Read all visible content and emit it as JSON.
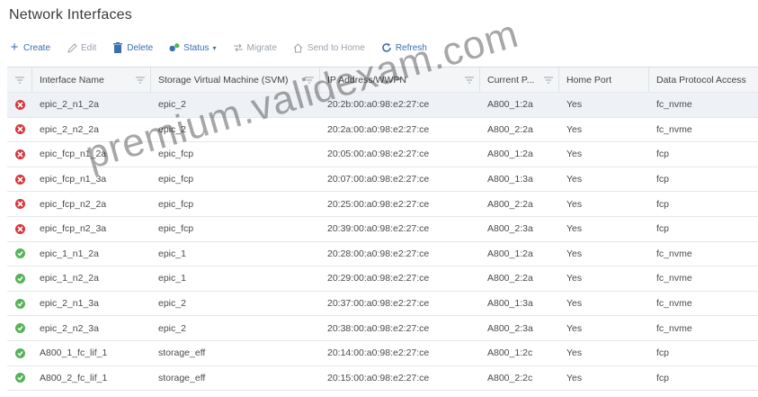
{
  "page": {
    "title": "Network Interfaces"
  },
  "toolbar": {
    "create": "Create",
    "edit": "Edit",
    "delete": "Delete",
    "status": "Status",
    "migrate": "Migrate",
    "send_home": "Send to Home",
    "refresh": "Refresh"
  },
  "colors": {
    "accent": "#3a6fb0",
    "error": "#d9363e",
    "ok": "#57b35a"
  },
  "table": {
    "columns": [
      "Interface Name",
      "Storage Virtual Machine (SVM)",
      "IP Address/WWPN",
      "Current P...",
      "Home Port",
      "Data Protocol Access"
    ],
    "rows": [
      {
        "status": "error",
        "name": "epic_2_n1_2a",
        "svm": "epic_2",
        "ip": "20:2b:00:a0:98:e2:27:ce",
        "port": "A800_1:2a",
        "home": "Yes",
        "proto": "fc_nvme"
      },
      {
        "status": "error",
        "name": "epic_2_n2_2a",
        "svm": "epic_2",
        "ip": "20:2a:00:a0:98:e2:27:ce",
        "port": "A800_2:2a",
        "home": "Yes",
        "proto": "fc_nvme"
      },
      {
        "status": "error",
        "name": "epic_fcp_n1_2a",
        "svm": "epic_fcp",
        "ip": "20:05:00:a0:98:e2:27:ce",
        "port": "A800_1:2a",
        "home": "Yes",
        "proto": "fcp"
      },
      {
        "status": "error",
        "name": "epic_fcp_n1_3a",
        "svm": "epic_fcp",
        "ip": "20:07:00:a0:98:e2:27:ce",
        "port": "A800_1:3a",
        "home": "Yes",
        "proto": "fcp"
      },
      {
        "status": "error",
        "name": "epic_fcp_n2_2a",
        "svm": "epic_fcp",
        "ip": "20:25:00:a0:98:e2:27:ce",
        "port": "A800_2:2a",
        "home": "Yes",
        "proto": "fcp"
      },
      {
        "status": "error",
        "name": "epic_fcp_n2_3a",
        "svm": "epic_fcp",
        "ip": "20:39:00:a0:98:e2:27:ce",
        "port": "A800_2:3a",
        "home": "Yes",
        "proto": "fcp"
      },
      {
        "status": "ok",
        "name": "epic_1_n1_2a",
        "svm": "epic_1",
        "ip": "20:28:00:a0:98:e2:27:ce",
        "port": "A800_1:2a",
        "home": "Yes",
        "proto": "fc_nvme"
      },
      {
        "status": "ok",
        "name": "epic_1_n2_2a",
        "svm": "epic_1",
        "ip": "20:29:00:a0:98:e2:27:ce",
        "port": "A800_2:2a",
        "home": "Yes",
        "proto": "fc_nvme"
      },
      {
        "status": "ok",
        "name": "epic_2_n1_3a",
        "svm": "epic_2",
        "ip": "20:37:00:a0:98:e2:27:ce",
        "port": "A800_1:3a",
        "home": "Yes",
        "proto": "fc_nvme"
      },
      {
        "status": "ok",
        "name": "epic_2_n2_3a",
        "svm": "epic_2",
        "ip": "20:38:00:a0:98:e2:27:ce",
        "port": "A800_2:3a",
        "home": "Yes",
        "proto": "fc_nvme"
      },
      {
        "status": "ok",
        "name": "A800_1_fc_lif_1",
        "svm": "storage_eff",
        "ip": "20:14:00:a0:98:e2:27:ce",
        "port": "A800_1:2c",
        "home": "Yes",
        "proto": "fcp"
      },
      {
        "status": "ok",
        "name": "A800_2_fc_lif_1",
        "svm": "storage_eff",
        "ip": "20:15:00:a0:98:e2:27:ce",
        "port": "A800_2:2c",
        "home": "Yes",
        "proto": "fcp"
      }
    ]
  },
  "watermark": "premium.validexam.com"
}
